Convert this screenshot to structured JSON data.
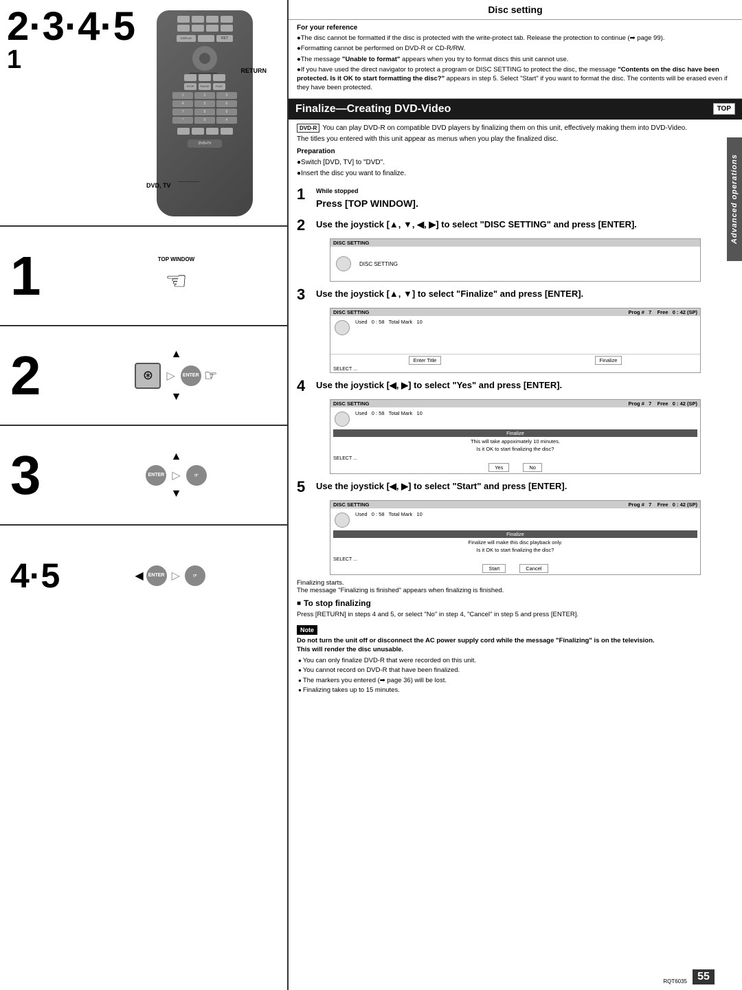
{
  "page": {
    "number": "55",
    "code": "RQT6035"
  },
  "left_panel": {
    "remote_labels": {
      "main_numbers": "2·3·4·5",
      "sub_number": "1",
      "return_label": "RETURN",
      "dvdtv_label": "DVD, TV"
    },
    "step1": {
      "number": "1",
      "label": "TOP WINDOW",
      "sub": "hand pointing at button"
    },
    "step2": {
      "number": "2",
      "description": "joystick all directions plus enter"
    },
    "step3": {
      "number": "3",
      "description": "enter buttons"
    },
    "step45": {
      "number": "4·5",
      "description": "joystick left right plus enter"
    }
  },
  "right_panel": {
    "disc_setting_title": "Disc setting",
    "for_your_reference": {
      "title": "For your reference",
      "bullets": [
        "The disc cannot be formatted if the disc is protected with the write-protect tab. Release the protection to continue (➡ page 99).",
        "Formatting cannot be performed on DVD-R or CD-R/RW.",
        "The message \"Unable to format\" appears when you try to format discs this unit cannot use.",
        "If you have used the direct navigator to protect a program or DISC SETTING to protect the disc, the message \"Contents on the disc have been protected. Is it OK to start formatting the disc?\" appears in step 5. Select \"Start\" if you want to format the disc. The contents will be erased even if they have been protected."
      ]
    },
    "finalize_header": "Finalize—Creating DVD-Video",
    "top_badge": "TOP",
    "dvdr_badge": "DVD-R",
    "dvdr_description": "You can play DVD-R on compatible DVD players by finalizing them on this unit, effectively making them into DVD-Video.",
    "dvdr_titles_note": "The titles you entered with this unit appear as menus when you play the finalized disc.",
    "preparation": {
      "title": "Preparation",
      "bullets": [
        "Switch [DVD, TV] to \"DVD\".",
        "Insert the disc you want to finalize."
      ]
    },
    "steps": [
      {
        "number": "1",
        "while_stopped": "While stopped",
        "instruction": "Press [TOP WINDOW]."
      },
      {
        "number": "2",
        "instruction": "Use the joystick [▲, ▼, ◀, ▶] to select \"DISC SETTING\" and press [ENTER].",
        "screen": {
          "label": "DISC SETTING",
          "has_disc_icon": true
        }
      },
      {
        "number": "3",
        "instruction": "Use the joystick [▲, ▼] to select \"Finalize\" and press [ENTER].",
        "screen": {
          "header_left": "DISC SETTING",
          "prog": "Prog #  7",
          "free": "Free",
          "free_val": "0 : 42 (SP)",
          "used": "Used",
          "used_val": "0 : 58",
          "total_mark": "Total Mark  10",
          "buttons": [
            "Enter Title",
            "Finalize"
          ],
          "select": "SELECT ..."
        }
      },
      {
        "number": "4",
        "instruction": "Use the joystick [◀, ▶] to select \"Yes\" and press [ENTER].",
        "screen": {
          "header_left": "DISC SETTING",
          "prog": "Prog #  7",
          "free": "Free",
          "free_val": "0 : 42 (SP)",
          "used": "Used",
          "used_val": "0 : 58",
          "total_mark": "Total Mark  10",
          "finalize_bar": "Finalize",
          "body_text": "This will take appoximately 10 minutes.\nIs it OK to start finalizing the disc?",
          "buttons": [
            "Yes",
            "No"
          ],
          "select": "SELECT ..."
        }
      },
      {
        "number": "5",
        "instruction": "Use the joystick [◀, ▶] to select \"Start\" and press [ENTER].",
        "screen": {
          "header_left": "DISC SETTING",
          "prog": "Prog #  7",
          "free": "Free",
          "free_val": "0 : 42 (SP)",
          "used": "Used",
          "used_val": "0 : 58",
          "total_mark": "Total Mark  10",
          "finalize_bar": "Finalize",
          "body_text": "Finalize will make this disc playback only.\nIs it OK to start finalizing the disc?",
          "buttons": [
            "Start",
            "Cancel"
          ],
          "select": "SELECT ..."
        }
      }
    ],
    "finalizing_starts": "Finalizing starts.",
    "finalizing_msg": "The message \"Finalizing is finished\" appears when finalizing is finished.",
    "to_stop": {
      "title": "To stop finalizing",
      "text": "Press [RETURN] in steps 4 and 5, or select \"No\" in step 4, \"Cancel\" in step 5 and press [ENTER]."
    },
    "note": {
      "label": "Note",
      "bold_text": "Do not turn the unit off or disconnect the AC power supply cord while the message \"Finalizing\" is on the television.\nThis will render the disc unusable.",
      "bullets": [
        "You can only finalize DVD-R that were recorded on this unit.",
        "You cannot record on DVD-R that have been finalized.",
        "The markers you entered (➡ page 36) will be lost.",
        "Finalizing takes up to 15 minutes."
      ]
    },
    "advanced_ops": "Advanced operations"
  }
}
